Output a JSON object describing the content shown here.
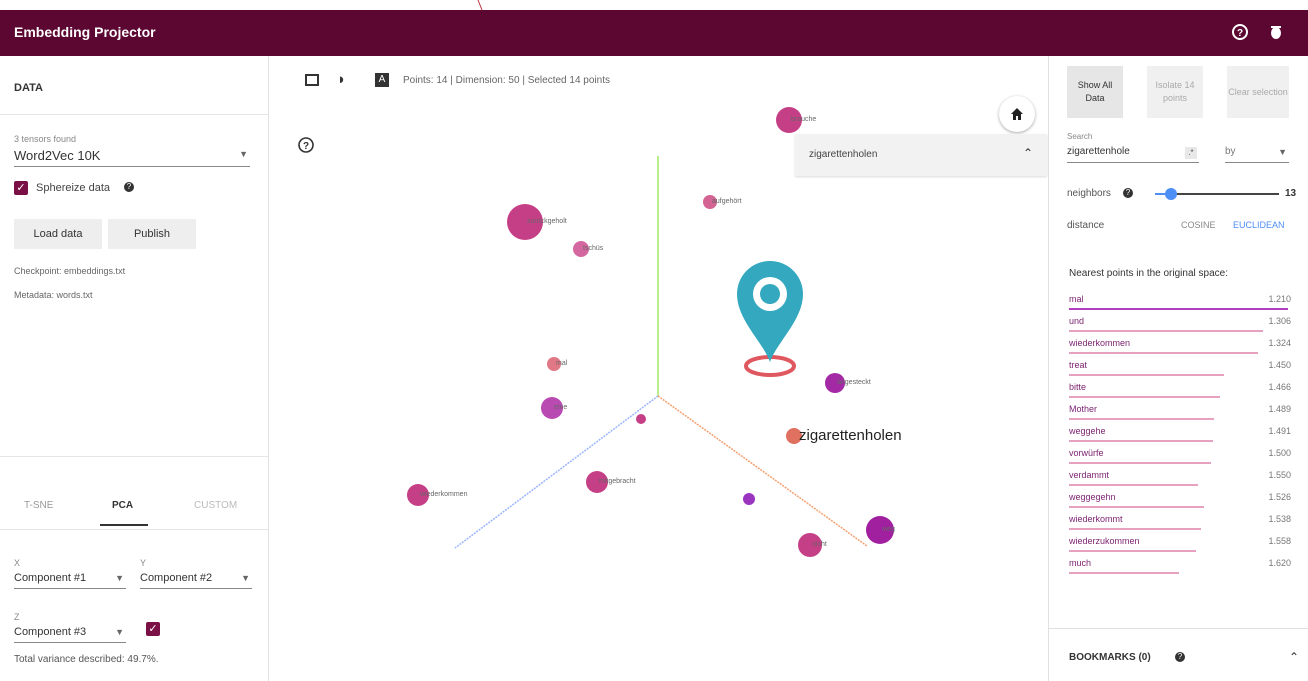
{
  "app": {
    "title": "Embedding Projector"
  },
  "data_panel": {
    "header": "DATA",
    "tensors_found": "3 tensors found",
    "tensor_selected": "Word2Vec 10K",
    "sphereize_label": "Sphereize data",
    "load_button": "Load data",
    "publish_button": "Publish",
    "checkpoint": "Checkpoint: embeddings.txt",
    "metadata": "Metadata: words.txt"
  },
  "projection_tabs": {
    "tsne": "T-SNE",
    "pca": "PCA",
    "custom": "CUSTOM",
    "active": "PCA"
  },
  "pca": {
    "x_label": "X",
    "x_value": "Component #1",
    "y_label": "Y",
    "y_value": "Component #2",
    "z_label": "Z",
    "z_value": "Component #3",
    "variance": "Total variance described: 49.7%."
  },
  "toolbar": {
    "status": "Points: 14 | Dimension: 50 | Selected 14 points"
  },
  "search_dropdown": {
    "value": "zigarettenholen"
  },
  "labels": {
    "big": "zigarettenholen"
  },
  "points": [
    {
      "label": "brauche",
      "color": "#c53f86"
    },
    {
      "label": "zurückgeholt",
      "color": "#c53f86"
    },
    {
      "label": "tschüs",
      "color": "#d466a0"
    },
    {
      "label": "aufgehört",
      "color": "#d36493"
    },
    {
      "label": "mal",
      "color": "#e07885"
    },
    {
      "label": "angesteckt",
      "color": "#a42aa5"
    },
    {
      "label": "eine",
      "color": "#b84ab2"
    },
    {
      "label": "dringend",
      "color": "#c53f86"
    },
    {
      "label": "zigarettenholen",
      "color": "#e07060"
    },
    {
      "label": "mitgebracht",
      "color": "#c53f86"
    },
    {
      "label": "wiederkommen",
      "color": "#c53f86"
    },
    {
      "label": "doch",
      "color": "#9b35c0"
    },
    {
      "label": "weg",
      "color": "#a020a0"
    },
    {
      "label": "nicht",
      "color": "#c53f86"
    }
  ],
  "right_panel": {
    "show_all": "Show All Data",
    "isolate": "Isolate 14 points",
    "clear": "Clear selection",
    "search_label": "Search",
    "search_value": "zigarettenhole",
    "by_label": "by",
    "neighbors_label": "neighbors",
    "neighbors_value": "13",
    "neighbors_fraction": 0.13,
    "distance_label": "distance",
    "cosine": "COSINE",
    "euclidean": "EUCLIDEAN",
    "nearest_header": "Nearest points in the original space:",
    "bookmarks": "BOOKMARKS (0)"
  },
  "nearest": [
    {
      "word": "mal",
      "value": "1.210"
    },
    {
      "word": "und",
      "value": "1.306"
    },
    {
      "word": "wiederkommen",
      "value": "1.324"
    },
    {
      "word": "treat",
      "value": "1.450"
    },
    {
      "word": "bitte",
      "value": "1.466"
    },
    {
      "word": "Mother",
      "value": "1.489"
    },
    {
      "word": "weggehe",
      "value": "1.491"
    },
    {
      "word": "vorwürfe",
      "value": "1.500"
    },
    {
      "word": "verdammt",
      "value": "1.550"
    },
    {
      "word": "weggegehn",
      "value": "1.526"
    },
    {
      "word": "wiederkommt",
      "value": "1.538"
    },
    {
      "word": "wiederzukommen",
      "value": "1.558"
    },
    {
      "word": "much",
      "value": "1.620"
    }
  ],
  "colors": {
    "brand": "#5c0632",
    "accent": "#7b1046",
    "pin": "#34a8bf",
    "pin_ring": "#e0585f",
    "link": "#4e8ef7"
  }
}
